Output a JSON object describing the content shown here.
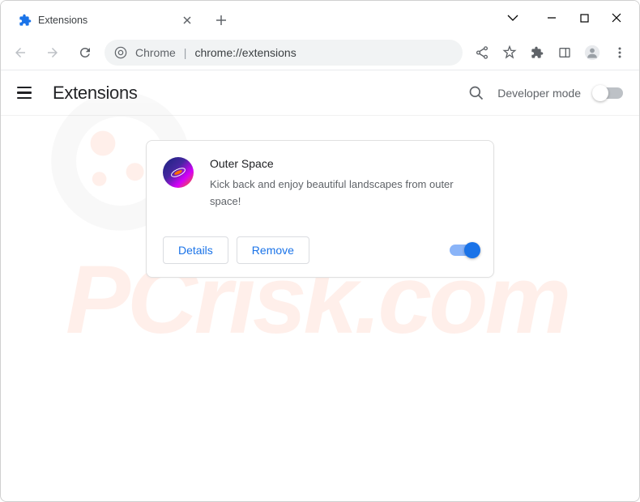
{
  "tab": {
    "title": "Extensions"
  },
  "omnibox": {
    "label": "Chrome",
    "url": "chrome://extensions"
  },
  "page": {
    "title": "Extensions",
    "developer_mode_label": "Developer mode"
  },
  "extension": {
    "name": "Outer Space",
    "description": "Kick back and enjoy beautiful landscapes from outer space!",
    "details_label": "Details",
    "remove_label": "Remove",
    "enabled": true
  },
  "watermark": {
    "text_pc": "PC",
    "text_risk": "risk",
    "text_com": ".com"
  }
}
